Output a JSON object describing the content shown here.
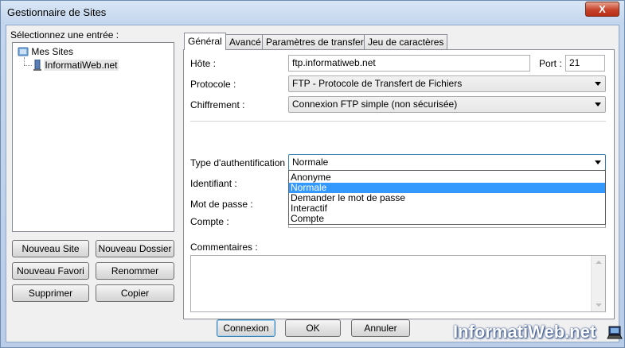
{
  "window": {
    "title": "Gestionnaire de Sites",
    "close_glyph": "X"
  },
  "left": {
    "label": "Sélectionnez une entrée :",
    "tree": [
      {
        "label": "Mes Sites",
        "icon": "folder-icon"
      },
      {
        "label": "InformatiWeb.net",
        "icon": "server-icon"
      }
    ],
    "buttons": {
      "new_site": "Nouveau Site",
      "new_folder": "Nouveau Dossier",
      "new_favorite": "Nouveau Favori",
      "rename": "Renommer",
      "delete": "Supprimer",
      "copy": "Copier"
    }
  },
  "tabs": [
    "Général",
    "Avancé",
    "Paramètres de transfert",
    "Jeu de caractères"
  ],
  "general": {
    "host_label": "Hôte :",
    "host_value": "ftp.informatiweb.net",
    "port_label": "Port :",
    "port_value": "21",
    "protocol_label": "Protocole :",
    "protocol_value": "FTP - Protocole de Transfert de Fichiers",
    "encryption_label": "Chiffrement :",
    "encryption_value": "Connexion FTP simple (non sécurisée)",
    "auth_label": "Type d'authentification :",
    "auth_value": "Normale",
    "auth_options": [
      "Anonyme",
      "Normale",
      "Demander le mot de passe",
      "Interactif",
      "Compte"
    ],
    "auth_selected_index": 1,
    "user_label": "Identifiant :",
    "password_label": "Mot de passe :",
    "account_label": "Compte :",
    "comments_label": "Commentaires :"
  },
  "footer": {
    "connect": "Connexion",
    "ok": "OK",
    "cancel": "Annuler"
  },
  "watermark": "InformatiWeb.net"
}
